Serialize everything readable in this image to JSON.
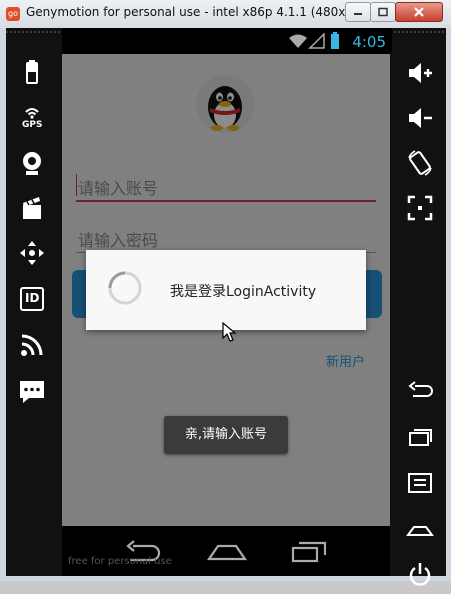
{
  "window": {
    "title": "Genymotion for personal use - intel x86p 4.1.1 (480x...",
    "app_icon_text": "go"
  },
  "status_bar": {
    "time": "4:05"
  },
  "login": {
    "account_placeholder": "请输入账号",
    "password_placeholder": "请输入密码",
    "new_user_link": "新用户"
  },
  "progress_dialog": {
    "message": "我是登录LoginActivity"
  },
  "toast": {
    "message": "亲,请输入账号"
  },
  "left_toolbar": [
    "battery-icon",
    "gps-icon",
    "camera-icon",
    "clapper-icon",
    "dpad-icon",
    "id-icon",
    "rss-icon",
    "sms-icon"
  ],
  "left_toolbar_labels": {
    "gps": "GPS",
    "id": "ID"
  },
  "right_toolbar": [
    "volume-up-icon",
    "volume-down-icon",
    "rotate-icon",
    "fullscreen-icon",
    "back-icon",
    "recents-icon",
    "menu-icon",
    "home-icon",
    "power-icon"
  ],
  "watermark": "free for personal use",
  "colors": {
    "accent": "#2a93d5",
    "focus_underline": "#c8385a",
    "clock": "#39b6e6"
  }
}
